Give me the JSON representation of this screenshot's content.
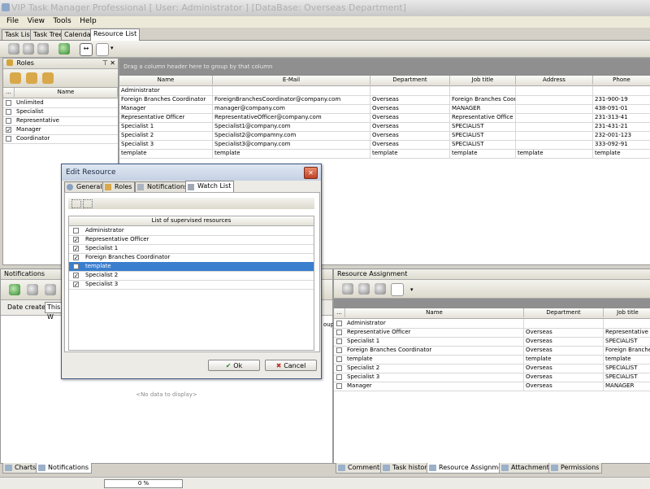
{
  "app": {
    "title": "VIP Task Manager Professional [ User: Administrator ] [DataBase: Overseas Department]"
  },
  "menu": [
    "File",
    "View",
    "Tools",
    "Help"
  ],
  "tabs": [
    "Task List",
    "Task Tree",
    "Calendar",
    "Resource List"
  ],
  "roles_panel": {
    "title": "Roles",
    "col_dots": "...",
    "col_name": "Name",
    "items": [
      {
        "label": "Unlimited",
        "checked": false
      },
      {
        "label": "Specialist",
        "checked": false
      },
      {
        "label": "Representative",
        "checked": false
      },
      {
        "label": "Manager",
        "checked": true
      },
      {
        "label": "Coordinator",
        "checked": false
      }
    ]
  },
  "resource_grid": {
    "group_hint": "Drag a column header here to group by that column",
    "columns": [
      "Name",
      "E-Mail",
      "Department",
      "Job title",
      "Address",
      "Phone"
    ],
    "rows": [
      [
        "Administrator",
        "",
        "",
        "",
        "",
        ""
      ],
      [
        "Foreign Branches Coordinator",
        "ForeignBranchesCoordinator@company.com",
        "Overseas",
        "Foreign Branches Coordi",
        "",
        "231-900-19"
      ],
      [
        "Manager",
        "manager@company.com",
        "Overseas",
        "MANAGER",
        "",
        "438-091-01"
      ],
      [
        "Representative Officer",
        "RepresentativeOfficer@company.com",
        "Overseas",
        "Representative Office",
        "",
        "231-313-41"
      ],
      [
        "Specialist 1",
        "Specialist1@company.com",
        "Overseas",
        "SPECIALIST",
        "",
        "231-431-21"
      ],
      [
        "Specialist 2",
        "Specialist2@compamny.com",
        "Overseas",
        "SPECIALIST",
        "",
        "232-001-123"
      ],
      [
        "Specialist 3",
        "Specialist3@company.com",
        "Overseas",
        "SPECIALIST",
        "",
        "333-092-91"
      ],
      [
        "template",
        "template",
        "template",
        "template",
        "template",
        "template"
      ]
    ]
  },
  "dialog": {
    "title": "Edit Resource",
    "tabs": [
      "General",
      "Roles",
      "Notifications",
      "Watch List"
    ],
    "list_header": "List of supervised resources",
    "items": [
      {
        "label": "Administrator",
        "checked": false
      },
      {
        "label": "Representative Officer",
        "checked": true
      },
      {
        "label": "Specialist 1",
        "checked": true
      },
      {
        "label": "Foreign Branches Coordinator",
        "checked": true
      },
      {
        "label": "template",
        "checked": false,
        "selected": true
      },
      {
        "label": "Specialist 2",
        "checked": true
      },
      {
        "label": "Specialist 3",
        "checked": true
      }
    ],
    "ok": "Ok",
    "cancel": "Cancel"
  },
  "notifications": {
    "title": "Notifications",
    "date_label": "Date created:",
    "date_value": "This W",
    "no_data": "<No data to display>",
    "cut_label": "oup"
  },
  "assignment": {
    "title": "Resource Assignment",
    "col_dots": "...",
    "columns": [
      "Name",
      "Department",
      "Job title"
    ],
    "rows": [
      [
        "Administrator",
        "",
        ""
      ],
      [
        "Representative Officer",
        "Overseas",
        "Representative C"
      ],
      [
        "Specialist 1",
        "Overseas",
        "SPECIALIST"
      ],
      [
        "Foreign Branches Coordinator",
        "Overseas",
        "Foreign Branches"
      ],
      [
        "template",
        "template",
        "template"
      ],
      [
        "Specialist 2",
        "Overseas",
        "SPECIALIST"
      ],
      [
        "Specialist 3",
        "Overseas",
        "SPECIALIST"
      ],
      [
        "Manager",
        "Overseas",
        "MANAGER"
      ]
    ]
  },
  "bottom_left_tabs": [
    "Charts",
    "Notifications"
  ],
  "bottom_right_tabs": [
    "Comments",
    "Task history",
    "Resource Assignment",
    "Attachments",
    "Permissions"
  ],
  "status": {
    "progress_text": "0 %",
    "progress": 0
  }
}
